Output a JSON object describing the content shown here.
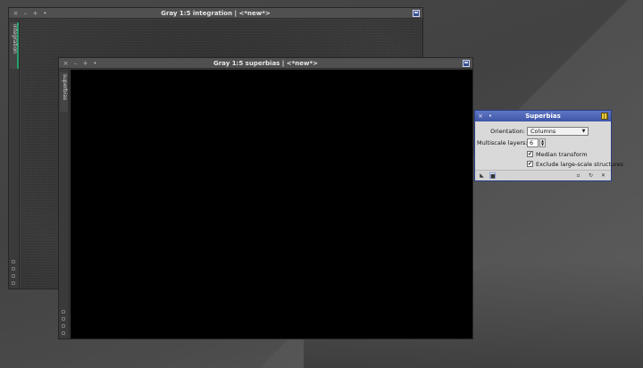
{
  "windows": {
    "integration": {
      "title": "Gray 1:5 integration | <*new*>",
      "tab_label": "integration",
      "controls": [
        "×",
        "–",
        "+",
        "•"
      ]
    },
    "superbias": {
      "title": "Gray 1:5 superbias | <*new*>",
      "tab_label": "superbias",
      "controls": [
        "×",
        "–",
        "+",
        "•"
      ]
    }
  },
  "dialog": {
    "title": "Superbias",
    "controls": [
      "×",
      "•"
    ],
    "orientation_label": "Orientation:",
    "orientation_value": "Columns",
    "layers_label": "Multiscale layers:",
    "layers_value": "6",
    "median_label": "Median transform",
    "median_checked": true,
    "exclude_label": "Exclude large-scale structures",
    "exclude_checked": true,
    "check_mark": "✔"
  },
  "colors": {
    "dialog_title": "#4a62b4",
    "accent_tab": "#29a06a",
    "image_black": "#000000"
  },
  "icons": {
    "new_instance": "triangle-icon",
    "apply_global": "square-icon",
    "browse_doc": "doc-icon",
    "reset": "reset-icon",
    "preferences": "wrench-icon"
  }
}
